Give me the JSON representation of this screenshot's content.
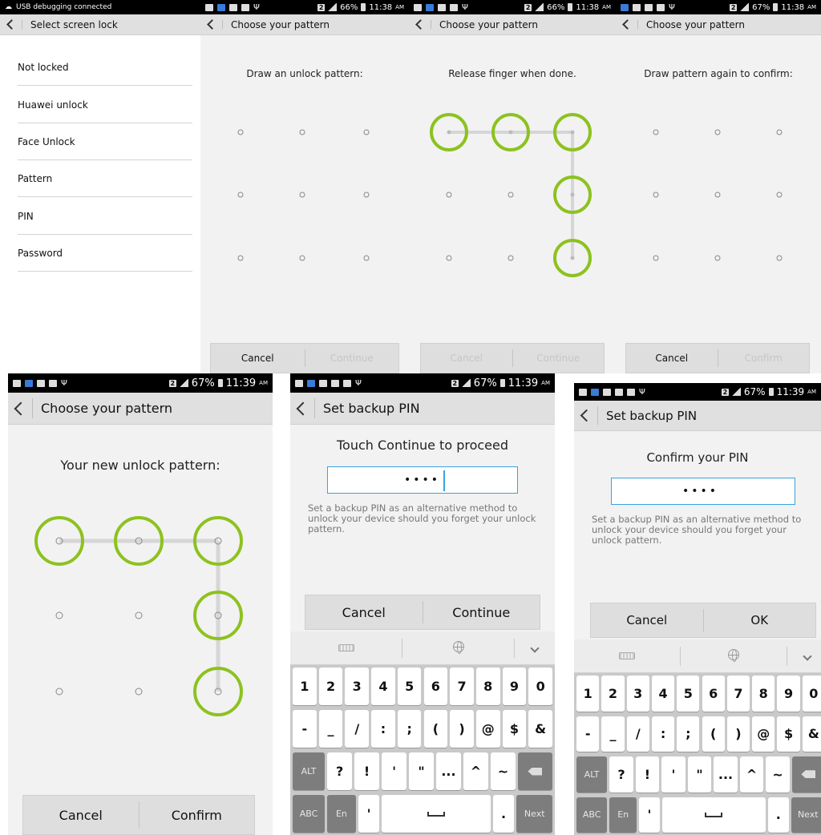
{
  "colors": {
    "accent_ring": "#8dc21f",
    "input_border": "#3aa2e0",
    "statusbar": "#000000",
    "actionbar": "#e0e0e0"
  },
  "icons": [
    "back-arrow-icon",
    "usb-debug-icon",
    "gallery-icon",
    "signal-icon",
    "battery-icon",
    "keyboard-icon",
    "globe-icon",
    "chevron-down-icon",
    "backspace-icon",
    "space-icon"
  ],
  "panels": [
    {
      "id": "select-screen-lock",
      "status": {
        "left_text": "USB debugging connected",
        "right_text": ""
      },
      "title": "Select screen lock",
      "items": [
        "Not locked",
        "Huawei unlock",
        "Face Unlock",
        "Pattern",
        "PIN",
        "Password"
      ]
    },
    {
      "id": "pattern-draw",
      "status": {
        "battery": "66%",
        "time": "11:38",
        "ampm": "AM"
      },
      "title": "Choose your pattern",
      "message": "Draw an unlock pattern:",
      "buttons": {
        "left": "Cancel",
        "right": "Continue",
        "left_enabled": true,
        "right_enabled": false
      }
    },
    {
      "id": "pattern-release",
      "status": {
        "battery": "66%",
        "time": "11:38",
        "ampm": "AM"
      },
      "title": "Choose your pattern",
      "message": "Release finger when done.",
      "selected_nodes": [
        1,
        2,
        3,
        6,
        9
      ],
      "buttons": {
        "left": "Cancel",
        "right": "Continue",
        "left_enabled": false,
        "right_enabled": false
      }
    },
    {
      "id": "pattern-confirm",
      "status": {
        "battery": "67%",
        "time": "11:38",
        "ampm": "AM"
      },
      "title": "Choose your pattern",
      "message": "Draw pattern again to confirm:",
      "buttons": {
        "left": "Cancel",
        "right": "Confirm",
        "left_enabled": true,
        "right_enabled": false
      }
    },
    {
      "id": "pattern-new",
      "status": {
        "battery": "67%",
        "time": "11:39",
        "ampm": "AM"
      },
      "title": "Choose your pattern",
      "message": "Your new unlock pattern:",
      "selected_nodes": [
        1,
        2,
        3,
        6,
        9
      ],
      "buttons": {
        "left": "Cancel",
        "right": "Confirm",
        "left_enabled": true,
        "right_enabled": true
      }
    },
    {
      "id": "backup-pin-set",
      "status": {
        "battery": "67%",
        "time": "11:39",
        "ampm": "AM"
      },
      "title": "Set backup PIN",
      "message": "Touch Continue to proceed",
      "pin_value": "••••",
      "description": "Set a backup PIN as an alternative method to unlock your device should you forget your unlock pattern.",
      "buttons": {
        "left": "Cancel",
        "right": "Continue",
        "left_enabled": true,
        "right_enabled": true
      }
    },
    {
      "id": "backup-pin-confirm",
      "status": {
        "battery": "67%",
        "time": "11:39",
        "ampm": "AM"
      },
      "title": "Set backup PIN",
      "message": "Confirm your PIN",
      "pin_value": "••••",
      "description": "Set a backup PIN as an alternative method to unlock your device should you forget your unlock pattern.",
      "buttons": {
        "left": "Cancel",
        "right": "OK",
        "left_enabled": true,
        "right_enabled": true
      }
    }
  ],
  "keyboard": {
    "row1": [
      "1",
      "2",
      "3",
      "4",
      "5",
      "6",
      "7",
      "8",
      "9",
      "0"
    ],
    "row2": [
      "-",
      "_",
      "/",
      ":",
      ";",
      "(",
      ")",
      "@",
      "$",
      "&"
    ],
    "row3": [
      "ALT",
      "?",
      "!",
      "'",
      "\"",
      "...",
      "^",
      "~",
      "⌫"
    ],
    "row4": [
      "ABC",
      "En",
      "'",
      "space",
      ".",
      "Next"
    ]
  }
}
